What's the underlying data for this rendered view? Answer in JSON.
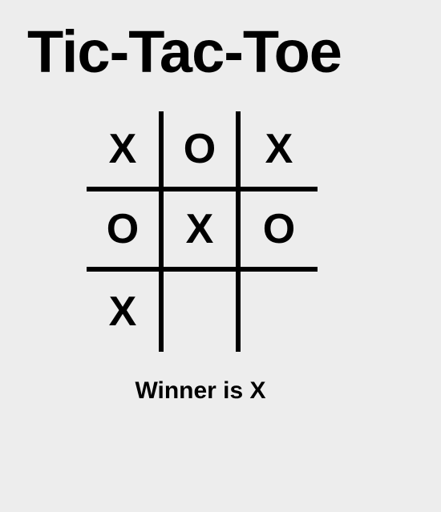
{
  "title": "Tic-Tac-Toe",
  "board": {
    "cells": [
      "X",
      "O",
      "X",
      "O",
      "X",
      "O",
      "X",
      "",
      ""
    ]
  },
  "status": "Winner is X"
}
